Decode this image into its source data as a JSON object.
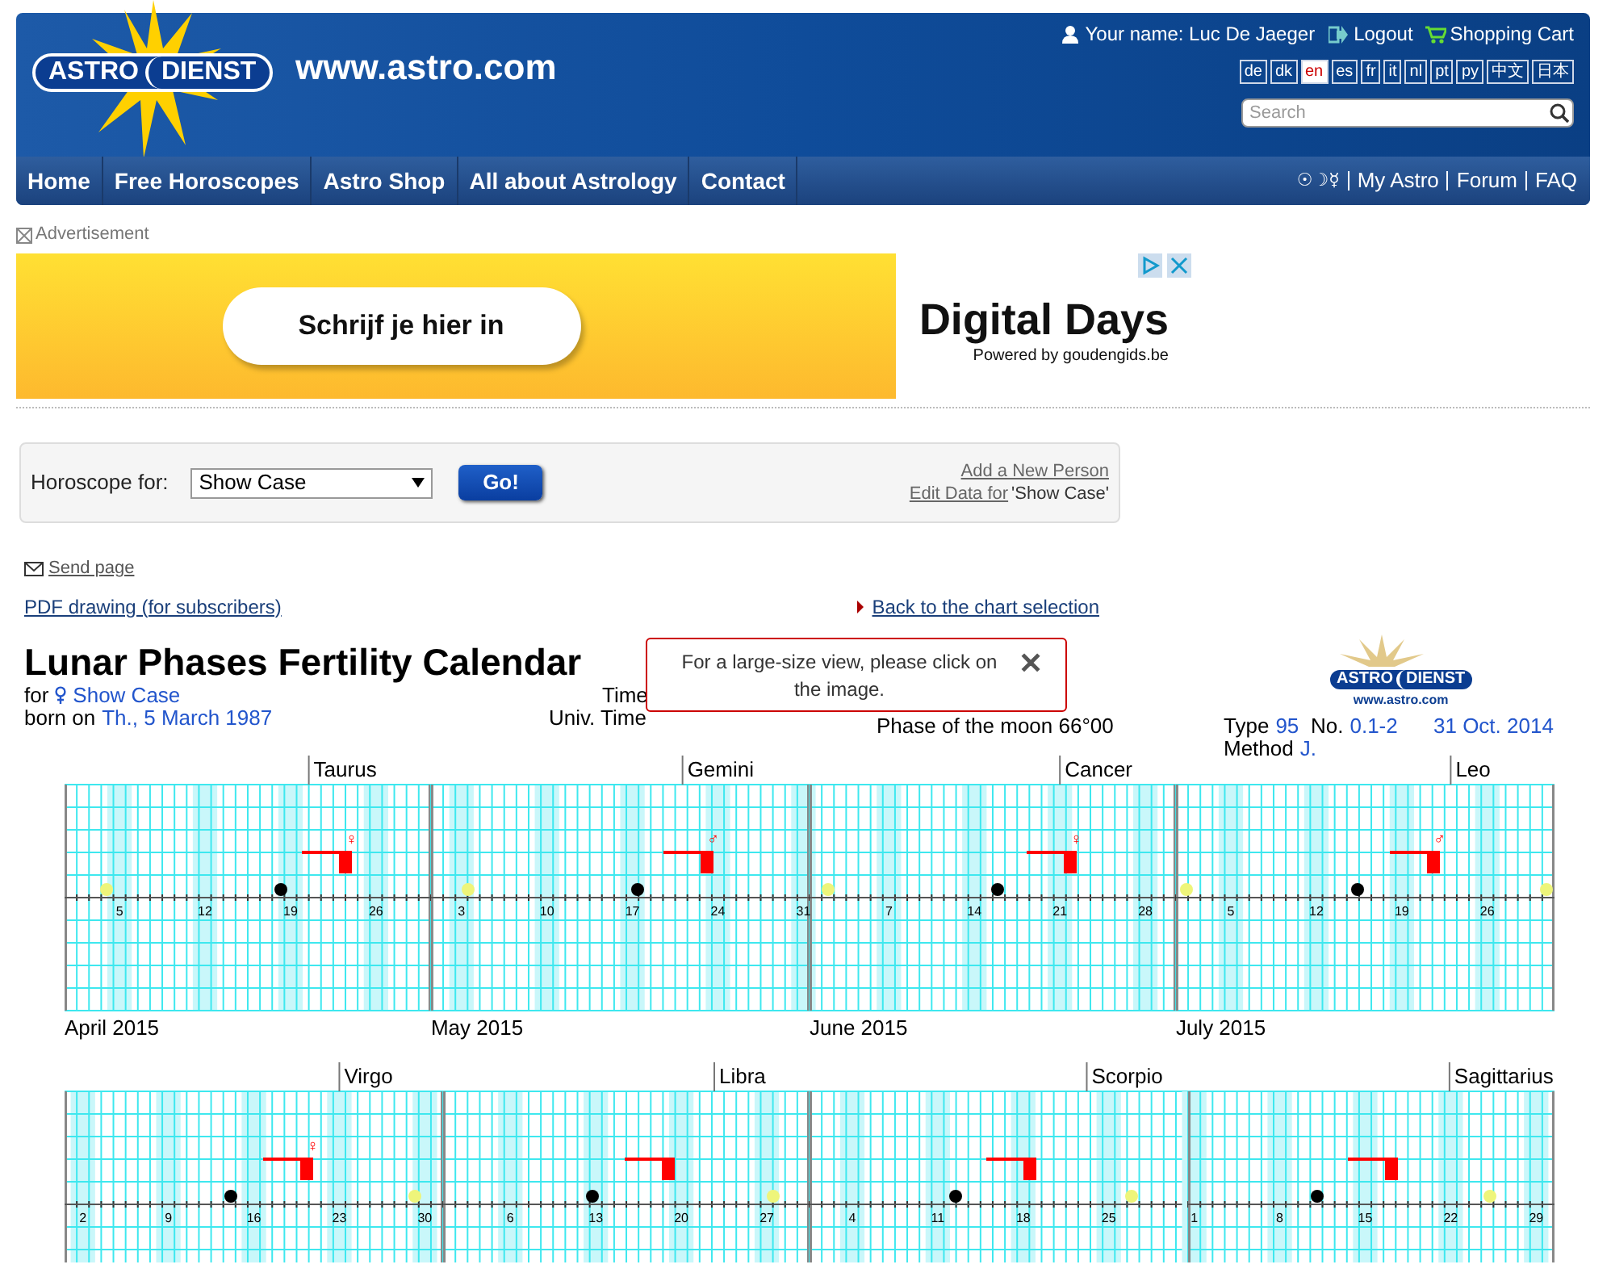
{
  "header": {
    "logo_left": "ASTRO",
    "logo_right": "DIENST",
    "site": "www.astro.com",
    "user": "Your name: Luc De Jaeger",
    "logout": "Logout",
    "cart": "Shopping Cart",
    "languages": [
      {
        "code": "de",
        "selected": false
      },
      {
        "code": "dk",
        "selected": false
      },
      {
        "code": "en",
        "selected": true
      },
      {
        "code": "es",
        "selected": false
      },
      {
        "code": "fr",
        "selected": false
      },
      {
        "code": "it",
        "selected": false
      },
      {
        "code": "nl",
        "selected": false
      },
      {
        "code": "pt",
        "selected": false
      },
      {
        "code": "py",
        "selected": false
      },
      {
        "code": "中文",
        "selected": false
      },
      {
        "code": "日本",
        "selected": false
      }
    ],
    "search": {
      "placeholder": "Search"
    }
  },
  "nav": {
    "items": [
      "Home",
      "Free Horoscopes",
      "Astro Shop",
      "All about Astrology",
      "Contact"
    ],
    "symbols": "☉☽☿",
    "links": [
      "My Astro",
      "Forum",
      "FAQ"
    ]
  },
  "ad": {
    "label": "Advertisement",
    "button": "Schrijf je hier in",
    "brand": "Digital Days",
    "powered": "Powered by goudengids.be"
  },
  "form": {
    "label": "Horoscope for:",
    "select": "Show Case",
    "go": "Go!",
    "add_link": "Add a New Person",
    "edit_link": "Edit Data for",
    "edit_name": "'Show Case'"
  },
  "links": {
    "send": "Send page",
    "pdf": "PDF drawing (for subscribers)",
    "back": "Back to the chart selection"
  },
  "chart_header": {
    "title": "Lunar Phases Fertility Calendar",
    "for_label": "for",
    "for_value": "Show Case",
    "born_label": "born on",
    "born_value": "Th., 5 March 1987",
    "time_label": "Time",
    "ut_label": "Univ. Time",
    "phase": "Phase of the moon 66°00",
    "type_label": "Type",
    "type_value": "95",
    "no_label": "No.",
    "no_value": "0.1-2",
    "date": "31 Oct. 2014",
    "method_label": "Method",
    "method_value": "J.",
    "logo_left": "ASTRO",
    "logo_right": "DIENST",
    "logo_url": "www.astro.com"
  },
  "popup": {
    "text": "For a large-size view, please click on the image.",
    "close": "✕"
  },
  "calendar": {
    "rows": [
      {
        "months": [
          {
            "sign": "Taurus",
            "label": "April 2015",
            "ticks": [
              "5",
              "12",
              "19",
              "26"
            ],
            "symbol": "♀"
          },
          {
            "sign": "Gemini",
            "label": "May 2015",
            "ticks": [
              "3",
              "10",
              "17",
              "24",
              "31"
            ],
            "symbol": "♂"
          },
          {
            "sign": "Cancer",
            "label": "June 2015",
            "ticks": [
              "7",
              "14",
              "21",
              "28"
            ],
            "symbol": "♀"
          },
          {
            "sign": "Leo",
            "label": "July 2015",
            "ticks": [
              "5",
              "12",
              "19",
              "26"
            ],
            "symbol": "♂"
          }
        ]
      },
      {
        "months": [
          {
            "sign": "Virgo",
            "ticks": [
              "2",
              "9",
              "16",
              "23",
              "30"
            ],
            "symbol": "♀"
          },
          {
            "sign": "Libra",
            "ticks": [
              "6",
              "13",
              "20",
              "27"
            ]
          },
          {
            "sign": "Scorpio",
            "ticks": [
              "4",
              "11",
              "18",
              "25"
            ]
          },
          {
            "sign": "Sagittarius",
            "ticks": [
              "1",
              "8",
              "15",
              "22",
              "29"
            ]
          }
        ]
      }
    ]
  }
}
